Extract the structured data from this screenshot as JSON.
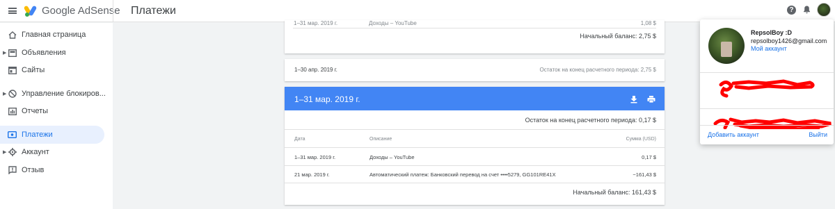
{
  "app": {
    "product_name": "Google AdSense",
    "page_title": "Платежи"
  },
  "sidebar": {
    "items": [
      {
        "label": "Главная страница",
        "icon": "home-icon",
        "expandable": false,
        "active": false
      },
      {
        "label": "Объявления",
        "icon": "ads-icon",
        "expandable": true,
        "active": false
      },
      {
        "label": "Сайты",
        "icon": "sites-icon",
        "expandable": false,
        "active": false
      },
      {
        "label": "Управление блокиров...",
        "icon": "block-icon",
        "expandable": true,
        "active": false
      },
      {
        "label": "Отчеты",
        "icon": "reports-icon",
        "expandable": false,
        "active": false
      },
      {
        "label": "Платежи",
        "icon": "payments-icon",
        "expandable": false,
        "active": true
      },
      {
        "label": "Аккаунт",
        "icon": "gear-icon",
        "expandable": true,
        "active": false
      },
      {
        "label": "Отзыв",
        "icon": "feedback-icon",
        "expandable": false,
        "active": false
      }
    ]
  },
  "payments": {
    "top_card": {
      "row_date": "1–31 мар. 2019 г.",
      "row_desc": "Доходы – YouTube",
      "row_amount": "1,08 $",
      "opening_balance": "Начальный баланс: 2,75 $"
    },
    "april_card": {
      "period": "1–30 апр. 2019 г.",
      "end_balance": "Остаток на конец расчетного периода: 2,75 $"
    },
    "march_card": {
      "period": "1–31 мар. 2019 г.",
      "end_balance": "Остаток на конец расчетного периода: 0,17 $",
      "columns": {
        "date": "Дата",
        "description": "Описание",
        "amount": "Сумма (USD)"
      },
      "rows": [
        {
          "date": "1–31 мар. 2019 г.",
          "description": "Доходы – YouTube",
          "amount": "0,17 $",
          "is_link": false
        },
        {
          "date": "21 мар. 2019 г.",
          "description": "Автоматический платеж: Банковский перевод на счет  ••••5279, GG101RE41X",
          "amount": "−161,43 $",
          "is_link": true
        }
      ],
      "opening_balance": "Начальный баланс: 161,43 $"
    }
  },
  "account_popup": {
    "name": "RepsolBoy :D",
    "email": "repsolboy1426@gmail.com",
    "my_account": "Мой аккаунт",
    "add_account": "Добавить аккаунт",
    "sign_out": "Выйти"
  },
  "colors": {
    "accent": "#4285f4",
    "link": "#1a73e8",
    "active_bg": "#e8f0fe",
    "redaction": "#ff0000"
  }
}
